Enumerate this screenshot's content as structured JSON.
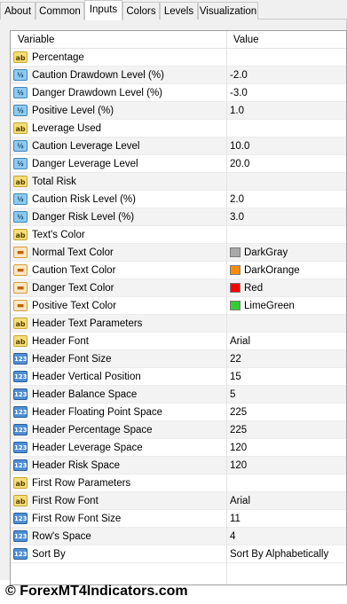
{
  "tabs": [
    {
      "label": "About",
      "active": false
    },
    {
      "label": "Common",
      "active": false
    },
    {
      "label": "Inputs",
      "active": true
    },
    {
      "label": "Colors",
      "active": false
    },
    {
      "label": "Levels",
      "active": false
    },
    {
      "label": "Visualization",
      "active": false
    }
  ],
  "table": {
    "col_variable": "Variable",
    "col_value": "Value",
    "rows": [
      {
        "icon": "ab",
        "icon_text": "ab",
        "variable": "Percentage",
        "value": ""
      },
      {
        "icon": "dbl",
        "icon_text": "½",
        "variable": "Caution Drawdown Level (%)",
        "value": "-2.0"
      },
      {
        "icon": "dbl",
        "icon_text": "½",
        "variable": "Danger Drawdown Level (%)",
        "value": "-3.0"
      },
      {
        "icon": "dbl",
        "icon_text": "½",
        "variable": "Positive Level (%)",
        "value": "1.0"
      },
      {
        "icon": "ab",
        "icon_text": "ab",
        "variable": "Leverage Used",
        "value": ""
      },
      {
        "icon": "dbl",
        "icon_text": "½",
        "variable": "Caution Leverage Level",
        "value": "10.0"
      },
      {
        "icon": "dbl",
        "icon_text": "½",
        "variable": "Danger Leverage Level",
        "value": "20.0"
      },
      {
        "icon": "ab",
        "icon_text": "ab",
        "variable": "Total Risk",
        "value": ""
      },
      {
        "icon": "dbl",
        "icon_text": "½",
        "variable": "Caution Risk Level (%)",
        "value": "2.0"
      },
      {
        "icon": "dbl",
        "icon_text": "½",
        "variable": "Danger Risk Level (%)",
        "value": "3.0"
      },
      {
        "icon": "ab",
        "icon_text": "ab",
        "variable": "Text's Color",
        "value": ""
      },
      {
        "icon": "clr",
        "icon_text": "▬",
        "variable": "Normal Text Color",
        "value": "DarkGray",
        "swatch": "#a9a9a9"
      },
      {
        "icon": "clr",
        "icon_text": "▬",
        "variable": "Caution Text Color",
        "value": "DarkOrange",
        "swatch": "#ff8c00"
      },
      {
        "icon": "clr",
        "icon_text": "▬",
        "variable": "Danger Text Color",
        "value": "Red",
        "swatch": "#ff0000"
      },
      {
        "icon": "clr",
        "icon_text": "▬",
        "variable": "Positive Text Color",
        "value": "LimeGreen",
        "swatch": "#32cd32"
      },
      {
        "icon": "ab",
        "icon_text": "ab",
        "variable": "Header Text Parameters",
        "value": ""
      },
      {
        "icon": "ab",
        "icon_text": "ab",
        "variable": "Header Font",
        "value": "Arial"
      },
      {
        "icon": "int",
        "icon_text": "123",
        "variable": "Header Font Size",
        "value": "22"
      },
      {
        "icon": "int",
        "icon_text": "123",
        "variable": "Header Vertical Position",
        "value": "15"
      },
      {
        "icon": "int",
        "icon_text": "123",
        "variable": "Header Balance Space",
        "value": "5"
      },
      {
        "icon": "int",
        "icon_text": "123",
        "variable": "Header Floating Point Space",
        "value": "225"
      },
      {
        "icon": "int",
        "icon_text": "123",
        "variable": "Header Percentage Space",
        "value": "225"
      },
      {
        "icon": "int",
        "icon_text": "123",
        "variable": "Header Leverage Space",
        "value": "120"
      },
      {
        "icon": "int",
        "icon_text": "123",
        "variable": "Header Risk Space",
        "value": "120"
      },
      {
        "icon": "ab",
        "icon_text": "ab",
        "variable": "First Row Parameters",
        "value": ""
      },
      {
        "icon": "ab",
        "icon_text": "ab",
        "variable": "First Row Font",
        "value": "Arial"
      },
      {
        "icon": "int",
        "icon_text": "123",
        "variable": "First Row Font Size",
        "value": "11"
      },
      {
        "icon": "int",
        "icon_text": "123",
        "variable": "Row's Space",
        "value": "4"
      },
      {
        "icon": "int",
        "icon_text": "123",
        "variable": "Sort By",
        "value": "Sort By Alphabetically"
      }
    ]
  },
  "footer": {
    "text": "© ForexMT4Indicators.com"
  }
}
